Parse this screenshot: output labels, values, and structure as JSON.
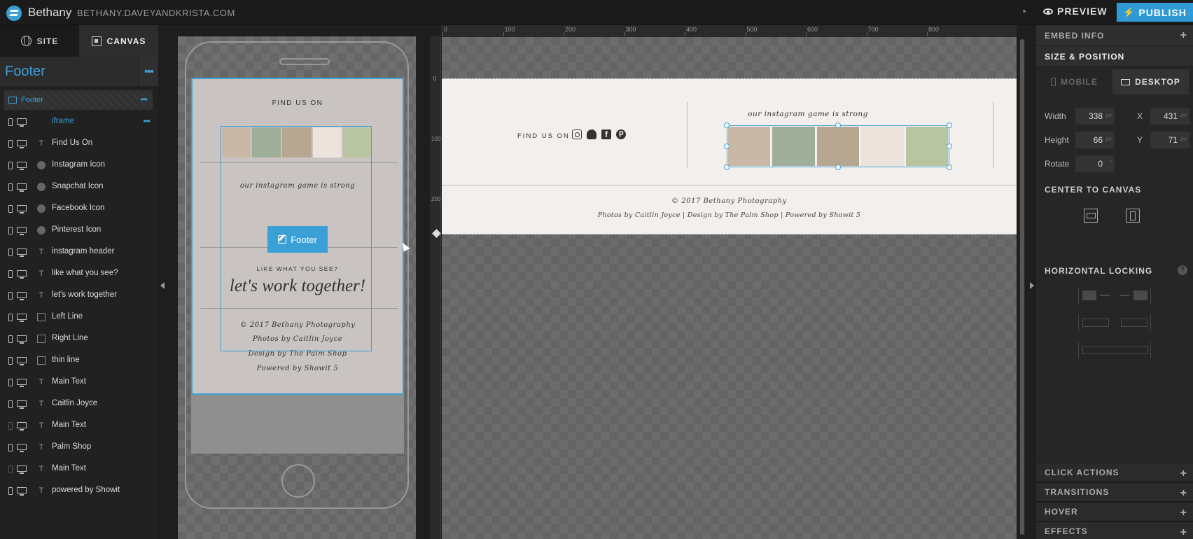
{
  "topbar": {
    "site_name": "Bethany",
    "site_domain": "BETHANY.DAVEYANDKRISTA.COM",
    "preview_label": "PREVIEW",
    "publish_label": "PUBLISH",
    "accent": "#2f9ad6"
  },
  "sidebar": {
    "tabs": [
      {
        "label": "SITE",
        "icon": "globe-icon"
      },
      {
        "label": "CANVAS",
        "icon": "canvas-icon"
      }
    ],
    "section_title": "Footer",
    "parent_layer": "Footer",
    "layers": [
      {
        "label": "iframe",
        "type": "code",
        "active": true
      },
      {
        "label": "Find Us On",
        "type": "text"
      },
      {
        "label": "Instagram Icon",
        "type": "icon"
      },
      {
        "label": "Snapchat Icon",
        "type": "icon"
      },
      {
        "label": "Facebook Icon",
        "type": "icon"
      },
      {
        "label": "Pinterest Icon",
        "type": "icon"
      },
      {
        "label": "instagram header",
        "type": "text"
      },
      {
        "label": "like what you see?",
        "type": "text"
      },
      {
        "label": "let's work together",
        "type": "text"
      },
      {
        "label": "Left Line",
        "type": "shape"
      },
      {
        "label": "Right Line",
        "type": "shape"
      },
      {
        "label": "thin line",
        "type": "shape"
      },
      {
        "label": "Main Text",
        "type": "text"
      },
      {
        "label": "Caitlin Joyce",
        "type": "text"
      },
      {
        "label": "Main Text",
        "type": "text"
      },
      {
        "label": "Palm Shop",
        "type": "text"
      },
      {
        "label": "Main Text",
        "type": "text"
      },
      {
        "label": "powered by Showit",
        "type": "text"
      }
    ]
  },
  "mobile": {
    "find_us": "FIND US ON",
    "insta_strong": "our instagram game is strong",
    "badge_label": "Footer",
    "like_what": "LIKE WHAT YOU SEE?",
    "work_together": "let's work together!",
    "copyright": "© 2017 Bethany Photography",
    "photos_by": "Photos by Caitlin Joyce",
    "design_by": "Design by The Palm Shop",
    "powered_by": "Powered by Showit 5"
  },
  "desktop": {
    "ruler_top": [
      "0",
      "100",
      "200",
      "300",
      "400",
      "500",
      "600",
      "700",
      "800"
    ],
    "ruler_left": [
      "0",
      "100",
      "200"
    ],
    "find_us": "FIND US ON",
    "social_icons": [
      "instagram-icon",
      "snapchat-icon",
      "facebook-icon",
      "pinterest-icon"
    ],
    "insta_strong": "our instagram game is strong",
    "copyright": "© 2017 Bethany Photography",
    "credits": "Photos by Caitlin Joyce  |  Design by The Palm Shop  |  Powered by Showit 5"
  },
  "panel": {
    "embed_info": "EMBED INFO",
    "size_position": "SIZE & POSITION",
    "mobile_tab": "MOBILE",
    "desktop_tab": "DESKTOP",
    "width_label": "Width",
    "width_value": "338",
    "height_label": "Height",
    "height_value": "66",
    "x_label": "X",
    "x_value": "431",
    "y_label": "Y",
    "y_value": "71",
    "rotate_label": "Rotate",
    "rotate_value": "0",
    "unit": "px",
    "degree": "°",
    "center_to_canvas": "CENTER TO CANVAS",
    "horizontal_locking": "HORIZONTAL LOCKING",
    "click_actions": "CLICK ACTIONS",
    "transitions": "TRANSITIONS",
    "hover": "HOVER",
    "effects": "EFFECTS"
  },
  "photo_colors": [
    "#c9b8a6",
    "#9fae9a",
    "#b8a790",
    "#ece3dc",
    "#b9c4a0"
  ]
}
